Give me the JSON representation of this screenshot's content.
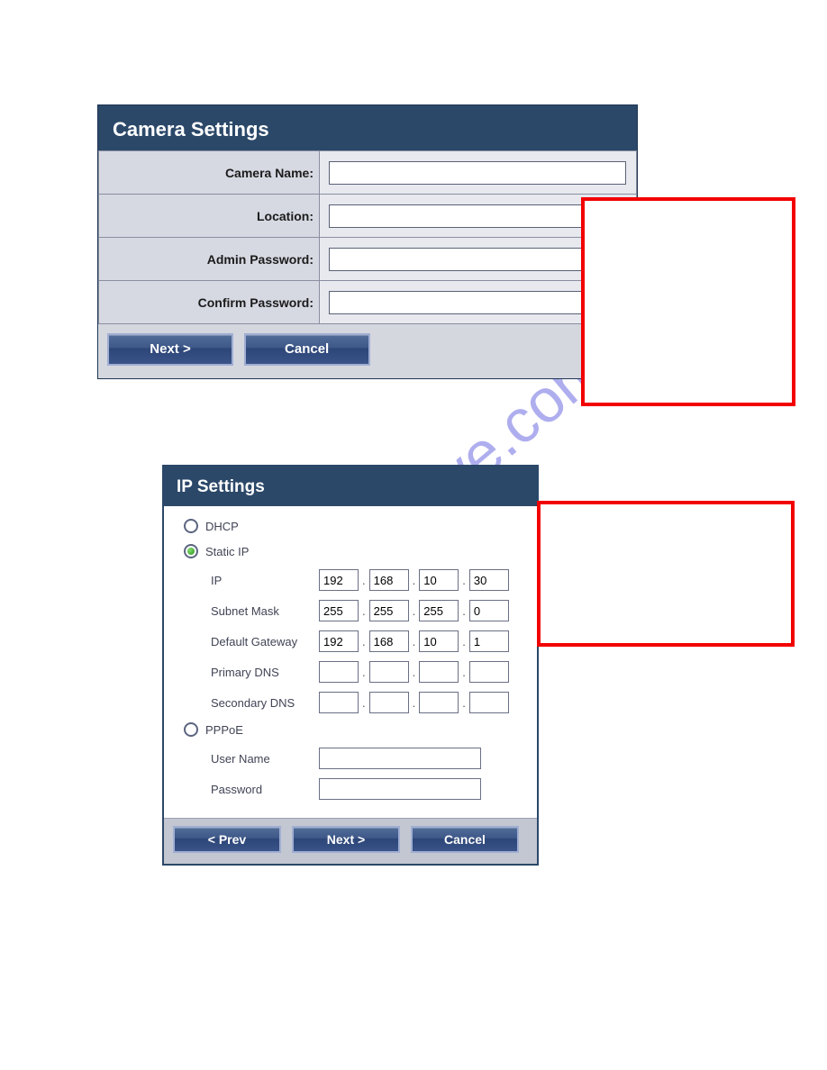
{
  "watermark": "manualshive.com",
  "panel1": {
    "title": "Camera Settings",
    "rows": {
      "camera_name": {
        "label": "Camera Name:",
        "value": ""
      },
      "location": {
        "label": "Location:",
        "value": ""
      },
      "admin_pw": {
        "label": "Admin Password:",
        "value": ""
      },
      "confirm_pw": {
        "label": "Confirm Password:",
        "value": ""
      }
    },
    "buttons": {
      "next": "Next >",
      "cancel": "Cancel"
    }
  },
  "panel2": {
    "title": "IP Settings",
    "radios": {
      "dhcp": {
        "label": "DHCP",
        "selected": false
      },
      "static": {
        "label": "Static IP",
        "selected": true
      },
      "pppoe": {
        "label": "PPPoE",
        "selected": false
      }
    },
    "static": {
      "ip": {
        "label": "IP",
        "octets": [
          "192",
          "168",
          "10",
          "30"
        ]
      },
      "subnet": {
        "label": "Subnet Mask",
        "octets": [
          "255",
          "255",
          "255",
          "0"
        ]
      },
      "gateway": {
        "label": "Default Gateway",
        "octets": [
          "192",
          "168",
          "10",
          "1"
        ]
      },
      "primary_dns": {
        "label": "Primary DNS",
        "octets": [
          "",
          "",
          "",
          ""
        ]
      },
      "secondary_dns": {
        "label": "Secondary DNS",
        "octets": [
          "",
          "",
          "",
          ""
        ]
      }
    },
    "pppoe_fields": {
      "username": {
        "label": "User Name",
        "value": ""
      },
      "password": {
        "label": "Password",
        "value": ""
      }
    },
    "buttons": {
      "prev": "< Prev",
      "next": "Next >",
      "cancel": "Cancel"
    }
  }
}
